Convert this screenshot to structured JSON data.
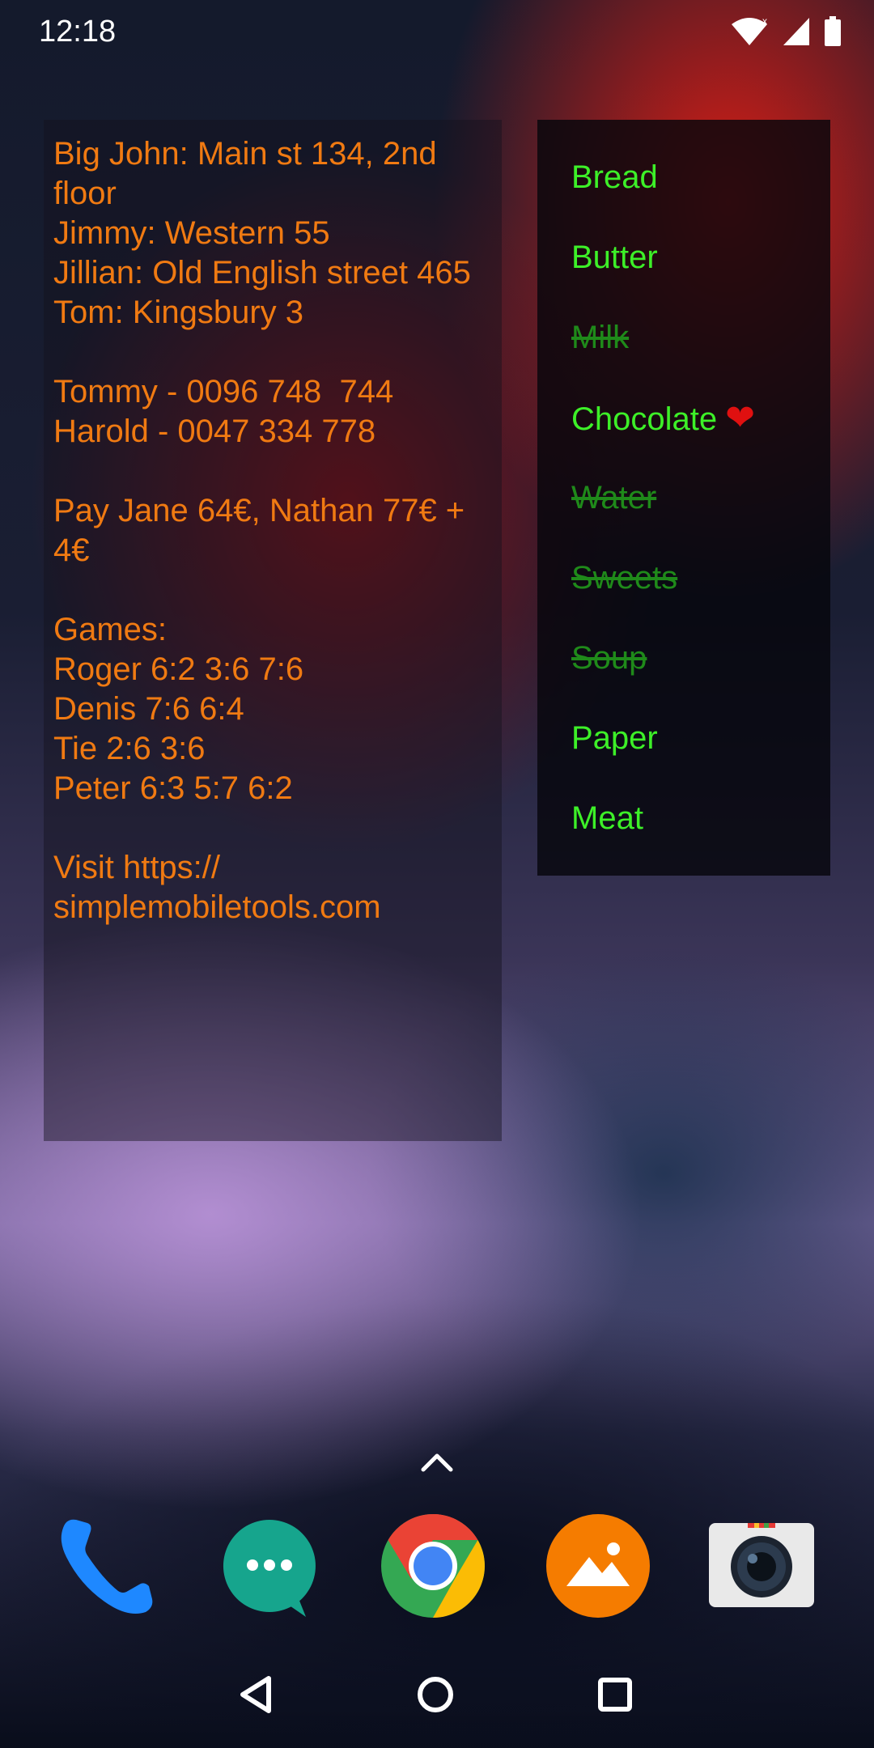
{
  "status_bar": {
    "time": "12:18",
    "icons": [
      "wifi-icon",
      "signal-icon",
      "battery-icon"
    ],
    "signal_badge": "x"
  },
  "notes_widget": {
    "text": "Big John: Main st 134, 2nd\nfloor\nJimmy: Western 55\nJillian: Old English street 465\nTom: Kingsbury 3\n\nTommy - 0096 748  744\nHarold - 0047 334 778\n\nPay Jane 64€, Nathan 77€ +\n4€\n\nGames:\nRoger 6:2 3:6 7:6\nDenis 7:6 6:4\nTie 2:6 3:6\nPeter 6:3 5:7 6:2\n\nVisit https://\nsimplemobiletools.com",
    "text_color": "#f07a12"
  },
  "checklist_widget": {
    "active_color": "#3df028",
    "done_color": "#1f8a1a",
    "items": [
      {
        "label": "Bread",
        "done": false
      },
      {
        "label": "Butter",
        "done": false
      },
      {
        "label": "Milk",
        "done": true
      },
      {
        "label": "Chocolate",
        "done": false,
        "emoji": "❤"
      },
      {
        "label": "Water",
        "done": true
      },
      {
        "label": "Sweets",
        "done": true
      },
      {
        "label": "Soup",
        "done": true
      },
      {
        "label": "Paper",
        "done": false
      },
      {
        "label": "Meat",
        "done": false
      }
    ]
  },
  "dock": {
    "apps": [
      "phone-app-icon",
      "messages-app-icon",
      "chrome-app-icon",
      "gallery-app-icon",
      "camera-app-icon"
    ]
  },
  "nav_bar": {
    "buttons": [
      "back-icon",
      "home-icon",
      "recents-icon"
    ]
  }
}
